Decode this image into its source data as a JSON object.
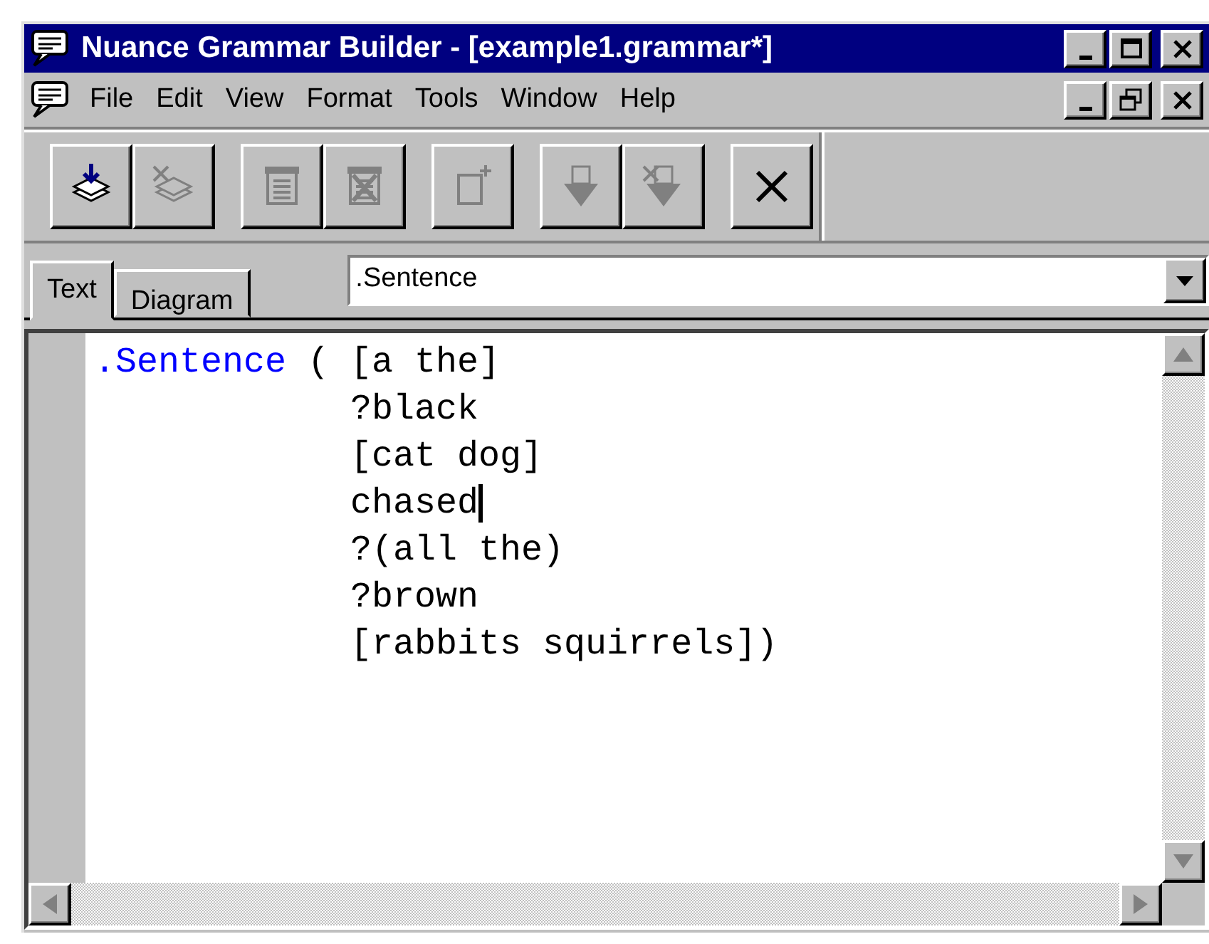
{
  "window": {
    "title": "Nuance Grammar Builder - [example1.grammar*]"
  },
  "menu": [
    {
      "label": "File"
    },
    {
      "label": "Edit"
    },
    {
      "label": "View"
    },
    {
      "label": "Format"
    },
    {
      "label": "Tools"
    },
    {
      "label": "Window"
    },
    {
      "label": "Help"
    }
  ],
  "toolbar": [
    {
      "kind": "load",
      "disabled": false,
      "group_start": true
    },
    {
      "kind": "unload",
      "disabled": true,
      "group_start": false
    },
    {
      "kind": "page",
      "disabled": true,
      "group_start": true
    },
    {
      "kind": "page-x",
      "disabled": true,
      "group_start": false
    },
    {
      "kind": "new",
      "disabled": true,
      "group_start": true
    },
    {
      "kind": "funnel",
      "disabled": true,
      "group_start": true
    },
    {
      "kind": "funnel-x",
      "disabled": true,
      "group_start": false
    },
    {
      "kind": "cancel",
      "disabled": false,
      "group_start": true
    }
  ],
  "tabs": [
    {
      "label": "Text",
      "selected": true
    },
    {
      "label": "Diagram",
      "selected": false
    }
  ],
  "grammar_select": {
    "value": ".Sentence"
  },
  "editor": {
    "lines": [
      {
        "keyword": ".Sentence",
        "text": " ( [a the]",
        "caret": false
      },
      {
        "text": "            ?black",
        "caret": false
      },
      {
        "text": "            [cat dog]",
        "caret": false
      },
      {
        "text": "            chased",
        "caret": true
      },
      {
        "text": "            ?(all the)",
        "caret": false
      },
      {
        "text": "            ?brown",
        "caret": false
      },
      {
        "text": "            [rabbits squirrels])",
        "caret": false
      }
    ]
  }
}
